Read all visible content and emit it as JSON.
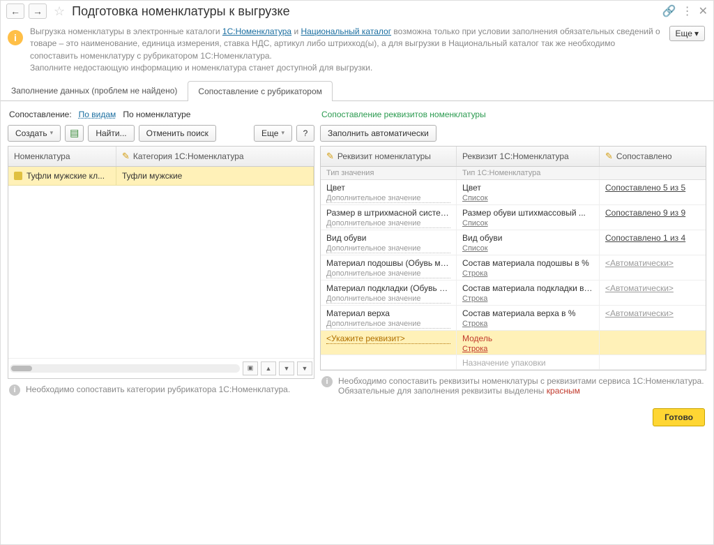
{
  "title": "Подготовка номенклатуры к выгрузке",
  "info_banner": {
    "prefix": "Выгрузка номенклатуры в электронные каталоги ",
    "link1": "1С:Номенклатура",
    "mid1": " и ",
    "link2": "Национальный каталог",
    "rest": " возможна только при условии заполнения обязательных сведений о товаре – это наименование, единица измерения, ставка НДС, артикул либо штрихкод(ы), а для выгрузки в Национальный каталог так же необходимо сопоставить номенклатуру с рубрикатором 1С:Номенклатура.",
    "line2": "Заполните недостающую информацию и номенклатура станет доступной для выгрузки."
  },
  "more_btn": "Еще",
  "tabs": {
    "t1": "Заполнение данных (проблем не найдено)",
    "t2": "Сопоставление с рубрикатором"
  },
  "left": {
    "match_label": "Сопоставление:",
    "mode_link": "По видам",
    "mode_text": "По номенклатуре",
    "btn_create": "Создать",
    "btn_find": "Найти...",
    "btn_cancel": "Отменить поиск",
    "btn_more": "Еще",
    "col1": "Номенклатура",
    "col2": "Категория 1С:Номенклатура",
    "row_name": "Туфли мужские кл...",
    "row_cat": "Туфли мужские",
    "hint": "Необходимо сопоставить категории рубрикатора 1С:Номенклатура."
  },
  "right": {
    "title": "Сопоставление реквизитов номенклатуры",
    "btn_fill": "Заполнить автоматически",
    "col1": "Реквизит номенклатуры",
    "col2": "Реквизит 1С:Номенклатура",
    "col3": "Сопоставлено",
    "sub1": "Тип значения",
    "sub2": "Тип 1С:Номенклатура",
    "select_placeholder": "<Укажите реквизит>",
    "auto_label": "<Автоматически>",
    "rows": [
      {
        "n": "Цвет",
        "ns": "Дополнительное значение",
        "r": "Цвет",
        "rs": "Список",
        "m": "Сопоставлено 5 из 5"
      },
      {
        "n": "Размер в штрихмасной системе",
        "ns": "Дополнительное значение",
        "r": "Размер обуви штихмассовый ...",
        "rs": "Список",
        "m": "Сопоставлено 9 из 9"
      },
      {
        "n": "Вид обуви",
        "ns": "Дополнительное значение",
        "r": "Вид обуви",
        "rs": "Список",
        "m": "Сопоставлено 1 из 4"
      },
      {
        "n": "Материал подошвы (Обувь ма...",
        "ns": "Дополнительное значение",
        "r": "Состав материала подошвы в %",
        "rs": "Строка",
        "m": "auto"
      },
      {
        "n": "Материал подкладки (Обувь м...",
        "ns": "Дополнительное значение",
        "r": "Состав материала подкладки в %",
        "rs": "Строка",
        "m": "auto"
      },
      {
        "n": "Материал верха",
        "ns": "Дополнительное значение",
        "r": "Состав материала верха в %",
        "rs": "Строка",
        "m": "auto"
      }
    ],
    "hl_rek": "Модель",
    "hl_sub": "Строка",
    "cut_row": "Назначение упаковки",
    "hint1": "Необходимо сопоставить реквизиты номенклатуры с реквизитами сервиса 1С:Номенклатура. Обязательные для заполнения реквизиты выделены ",
    "hint_red": "красным"
  },
  "footer_btn": "Готово"
}
